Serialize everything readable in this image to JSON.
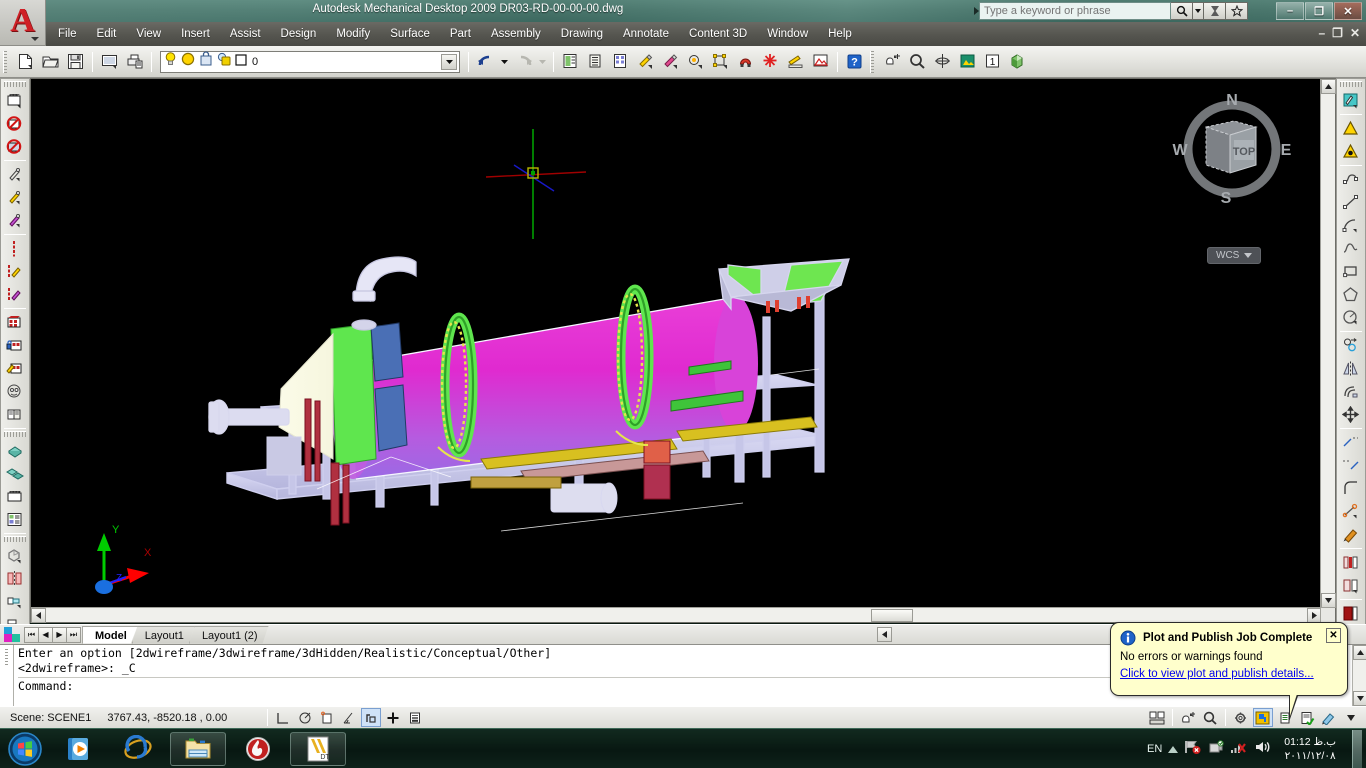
{
  "window": {
    "title": "Autodesk Mechanical Desktop 2009 DR03-RD-00-00-00.dwg",
    "minimize": "–",
    "maximize": "❐",
    "close": "✕"
  },
  "infocenter": {
    "placeholder": "Type a keyword or phrase",
    "search_icon": "search-icon",
    "dropdown_icon": "chevron-down-icon",
    "comm_icon": "communication-center-icon",
    "fav_icon": "favorites-star-icon"
  },
  "menu": {
    "items": [
      {
        "label": "File"
      },
      {
        "label": "Edit"
      },
      {
        "label": "View"
      },
      {
        "label": "Insert"
      },
      {
        "label": "Assist"
      },
      {
        "label": "Design"
      },
      {
        "label": "Modify"
      },
      {
        "label": "Surface"
      },
      {
        "label": "Part"
      },
      {
        "label": "Assembly"
      },
      {
        "label": "Drawing"
      },
      {
        "label": "Annotate"
      },
      {
        "label": "Content 3D"
      },
      {
        "label": "Window"
      },
      {
        "label": "Help"
      }
    ],
    "doc_minimize": "–",
    "doc_restore": "❐",
    "doc_close": "✕"
  },
  "toolbar": {
    "left_icons": [
      {
        "name": "new-file-icon"
      },
      {
        "name": "open-folder-icon"
      },
      {
        "name": "save-icon"
      }
    ],
    "second_icons": [
      {
        "name": "plot-preview-icon"
      },
      {
        "name": "plot-icon"
      }
    ],
    "layer": {
      "bulb_icon": "layer-on-bulb-icon",
      "sun_icon": "layer-freeze-sun-icon",
      "lock_icon": "layer-lock-icon",
      "plot_icon": "layer-plot-icon",
      "color_icon": "layer-color-swatch-icon",
      "name": "0",
      "dropdown_icon": "chevron-down-icon"
    },
    "undo_label": "undo-icon",
    "redo_label": "redo-icon",
    "mid_icons": [
      {
        "name": "properties-icon"
      },
      {
        "name": "designcenter-icon"
      },
      {
        "name": "tool-palettes-icon"
      },
      {
        "name": "match-properties-icon"
      },
      {
        "name": "edit-hatch-icon"
      },
      {
        "name": "block-editor-icon"
      },
      {
        "name": "power-dimension-icon"
      },
      {
        "name": "magnet-fit-icon"
      },
      {
        "name": "power-snap-icon"
      },
      {
        "name": "power-edit-icon"
      },
      {
        "name": "power-view-icon"
      }
    ],
    "help_icon": "help-question-icon",
    "right_icons": [
      {
        "name": "pan-realtime-icon"
      },
      {
        "name": "zoom-realtime-icon"
      },
      {
        "name": "3d-orbit-icon"
      },
      {
        "name": "render-icon"
      },
      {
        "name": "named-views-icon"
      },
      {
        "name": "visual-styles-icon"
      }
    ]
  },
  "left_toolbar": {
    "groups": [
      {
        "items": [
          {
            "name": "new-scene-icon"
          },
          {
            "name": "delete-scene-icon"
          },
          {
            "name": "hide-scene-icon"
          }
        ]
      },
      {
        "items": [
          {
            "name": "drawing-view-icon"
          },
          {
            "name": "base-view-icon"
          },
          {
            "name": "ortho-view-icon"
          }
        ]
      },
      {
        "items": [
          {
            "name": "break-line-icon"
          },
          {
            "name": "detail-view-icon"
          },
          {
            "name": "broken-view-icon"
          }
        ]
      },
      {
        "items": [
          {
            "name": "edit-view-icon"
          },
          {
            "name": "lock-view-icon"
          },
          {
            "name": "update-view-icon"
          },
          {
            "name": "hide-situation-icon"
          },
          {
            "name": "drawing-catalog-icon"
          }
        ]
      },
      {
        "items": [
          {
            "name": "part-reference-icon"
          },
          {
            "name": "multi-part-icon"
          },
          {
            "name": "annotate-part-icon"
          },
          {
            "name": "options-layout-icon"
          }
        ]
      },
      {
        "items": [
          {
            "name": "assembly-icon"
          },
          {
            "name": "mirror-part-icon"
          },
          {
            "name": "scale-part-icon"
          },
          {
            "name": "insert-arrow-icon"
          },
          {
            "name": "browser-table-icon"
          },
          {
            "name": "palette-color-icon"
          }
        ]
      }
    ]
  },
  "right_toolbar": {
    "groups": [
      {
        "items": [
          {
            "name": "design-variables-icon"
          }
        ]
      },
      {
        "items": [
          {
            "name": "cone-warning-icon"
          },
          {
            "name": "cone-alert-icon"
          }
        ]
      },
      {
        "items": [
          {
            "name": "spline-path-icon"
          },
          {
            "name": "line-segment-icon"
          },
          {
            "name": "arc-icon"
          },
          {
            "name": "spline-icon"
          },
          {
            "name": "rectangle-icon"
          },
          {
            "name": "polygon-icon"
          },
          {
            "name": "circle-radius-icon"
          }
        ]
      },
      {
        "items": [
          {
            "name": "copy-object-icon"
          },
          {
            "name": "mirror-object-icon"
          },
          {
            "name": "offset-icon"
          },
          {
            "name": "move-icon"
          }
        ]
      },
      {
        "items": [
          {
            "name": "extend-icon"
          },
          {
            "name": "trim-icon"
          },
          {
            "name": "fillet-icon"
          },
          {
            "name": "chamfer-icon"
          },
          {
            "name": "erase-icon"
          }
        ]
      },
      {
        "items": [
          {
            "name": "power-dim-left-icon"
          },
          {
            "name": "power-dim-right-icon"
          }
        ]
      },
      {
        "items": [
          {
            "name": "annotate-red-icon"
          },
          {
            "name": "annotate-red2-icon"
          }
        ]
      }
    ]
  },
  "viewcube": {
    "north": "N",
    "east": "E",
    "south": "S",
    "west": "W",
    "face": "TOP",
    "wcs_label": "WCS",
    "wcs_caret_icon": "chevron-down-icon"
  },
  "ucs": {
    "x_label": "X",
    "y_label": "Y",
    "z_label": "Z"
  },
  "tabs": {
    "nav": [
      {
        "name": "first-layout-button",
        "glyph": "⏮"
      },
      {
        "name": "prev-layout-button",
        "glyph": "◀"
      },
      {
        "name": "next-layout-button",
        "glyph": "▶"
      },
      {
        "name": "last-layout-button",
        "glyph": "⏭"
      }
    ],
    "items": [
      {
        "label": "Model",
        "active": true
      },
      {
        "label": "Layout1",
        "active": false
      },
      {
        "label": "Layout1 (2)",
        "active": false
      }
    ],
    "scroll_icon": "scroll-left-icon"
  },
  "command": {
    "line1": "Enter an option [2dwireframe/3dwireframe/3dHidden/Realistic/Conceptual/Other]",
    "line2": "<2dwireframe>: _C",
    "line3": "Command:"
  },
  "status": {
    "scene_label": "Scene: SCENE1",
    "coords": "3767.43, -8520.18 , 0.00",
    "left_buttons": [
      {
        "name": "ortho-mode-button",
        "on": false
      },
      {
        "name": "polar-tracking-button",
        "on": false
      },
      {
        "name": "object-snap-button",
        "on": false
      },
      {
        "name": "otrack-button",
        "on": false
      },
      {
        "name": "dynamic-ucs-button",
        "on": true
      },
      {
        "name": "dynamic-input-button",
        "on": false
      },
      {
        "name": "lineweight-button",
        "on": false
      }
    ],
    "right_buttons": [
      {
        "name": "model-layout-switch-button",
        "on": false
      },
      {
        "name": "quick-view-drawings-button",
        "on": false
      },
      {
        "name": "pan-button",
        "on": false
      },
      {
        "name": "zoom-button",
        "on": false
      },
      {
        "name": "annotation-scale-gear-button",
        "on": false
      },
      {
        "name": "workspace-switch-button",
        "on": true
      },
      {
        "name": "toolbar-lock-button",
        "on": false
      },
      {
        "name": "status-tray-check-button",
        "on": false
      },
      {
        "name": "clean-screen-button",
        "on": false
      },
      {
        "name": "status-overflow-button",
        "on": false
      }
    ]
  },
  "balloon": {
    "icon": "info-icon",
    "title": "Plot and Publish Job Complete",
    "body": "No errors or warnings found",
    "link": "Click to view plot and publish details...",
    "close_label": "✕"
  },
  "taskbar": {
    "start_icon": "windows-start-orb-icon",
    "items": [
      {
        "name": "taskbar-windows-media-player",
        "icon": "media-player-icon",
        "framed": false
      },
      {
        "name": "taskbar-internet-explorer",
        "icon": "internet-explorer-icon",
        "framed": false
      },
      {
        "name": "taskbar-windows-explorer",
        "icon": "folder-explorer-icon",
        "framed": true
      },
      {
        "name": "taskbar-nero-burning",
        "icon": "flame-disc-icon",
        "framed": false
      },
      {
        "name": "taskbar-mechanical-desktop",
        "icon": "autocad-dt-icon",
        "framed": true,
        "label": "DT"
      }
    ],
    "tray": {
      "language": "EN",
      "expand_icon": "chevron-up-icon",
      "icons": [
        {
          "name": "network-error-icon"
        },
        {
          "name": "removable-device-icon"
        },
        {
          "name": "signal-muted-icon"
        },
        {
          "name": "volume-icon"
        }
      ],
      "time": "01:12 ب.ظ",
      "date": "٢٠١١/١٢/٠٨"
    }
  },
  "colors": {
    "title_teal": "#3e6c62",
    "menu_gray": "#55554f",
    "canvas_black": "#000000",
    "balloon_yellow": "#ffffcc",
    "link_blue": "#0000ee",
    "model_magenta": "#e040e0",
    "model_green": "#55dd44",
    "model_lavender": "#c6c6e8",
    "ucs_x_red": "#ff0000",
    "ucs_y_green": "#00cc00",
    "ucs_z_blue": "#2020ff"
  }
}
